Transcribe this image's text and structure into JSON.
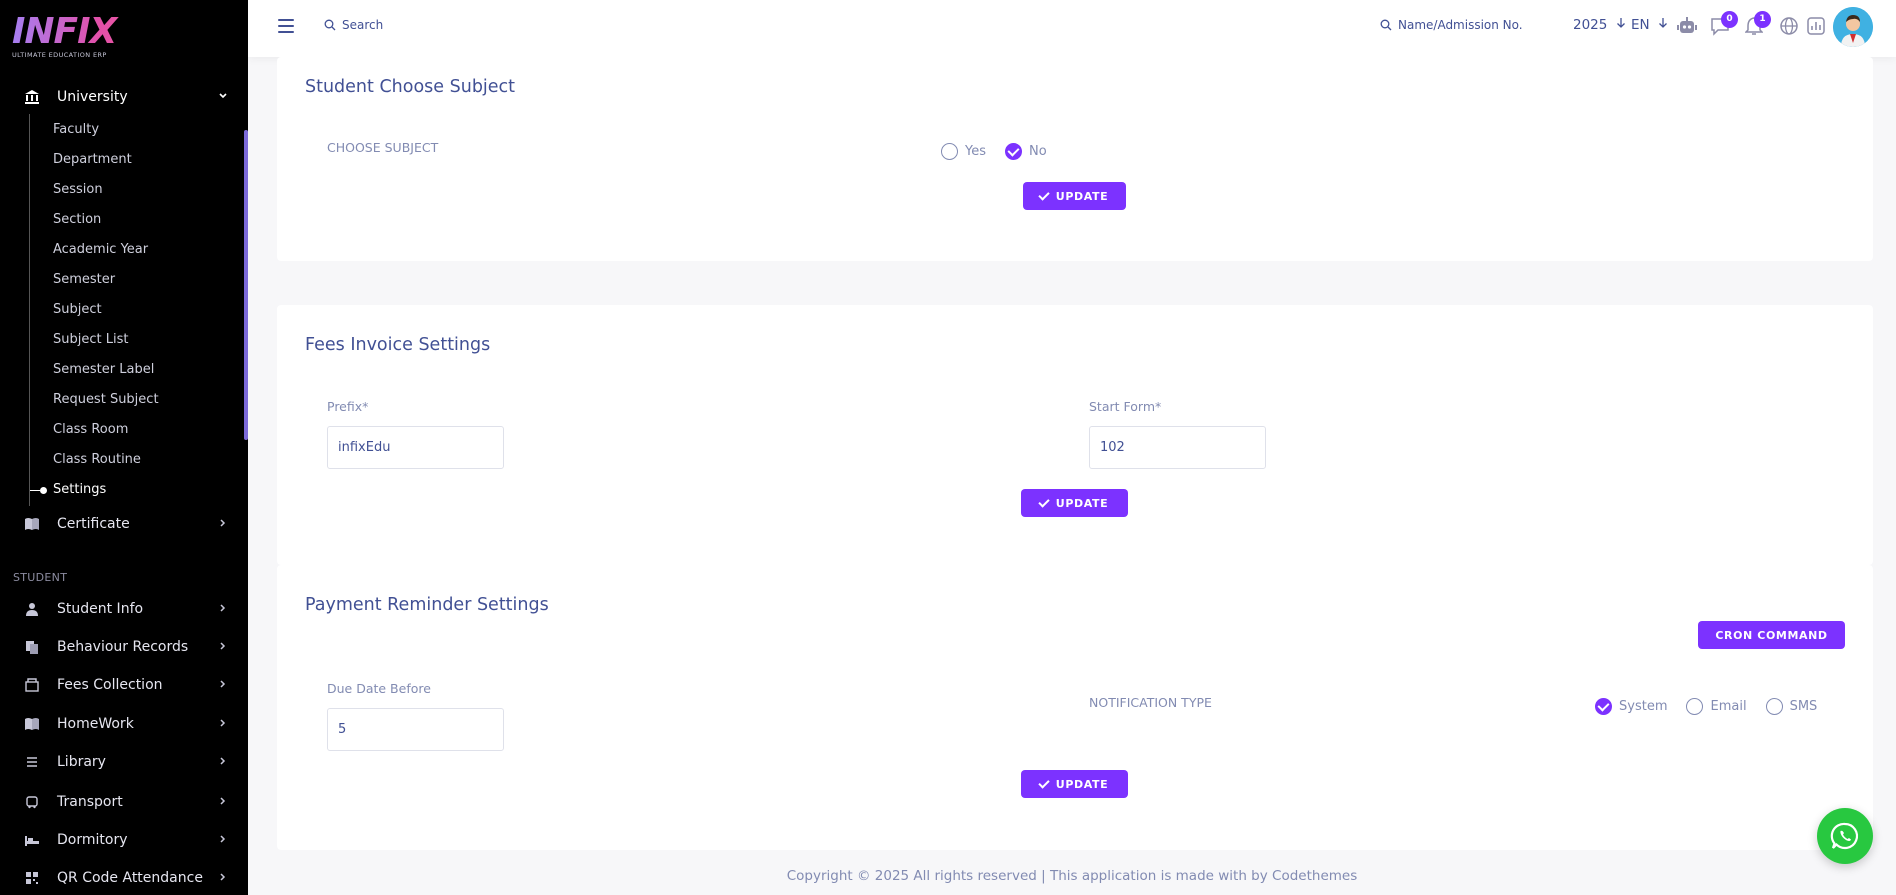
{
  "brand": {
    "logo_text": "INFIX",
    "tagline": "ULTIMATE EDUCATION ERP"
  },
  "sidebar": {
    "university": {
      "label": "University",
      "expanded": true
    },
    "sub_items": [
      {
        "label": "Faculty"
      },
      {
        "label": "Department"
      },
      {
        "label": "Session"
      },
      {
        "label": "Section"
      },
      {
        "label": "Academic Year"
      },
      {
        "label": "Semester"
      },
      {
        "label": "Subject"
      },
      {
        "label": "Subject List"
      },
      {
        "label": "Semester Label"
      },
      {
        "label": "Request Subject"
      },
      {
        "label": "Class Room"
      },
      {
        "label": "Class Routine"
      },
      {
        "label": "Settings",
        "active": true
      }
    ],
    "certificate": {
      "label": "Certificate"
    },
    "section_student": "STUDENT",
    "student_items": [
      {
        "label": "Student Info",
        "icon": "user-icon"
      },
      {
        "label": "Behaviour Records",
        "icon": "records-icon"
      },
      {
        "label": "Fees Collection",
        "icon": "fees-icon"
      },
      {
        "label": "HomeWork",
        "icon": "book-icon"
      },
      {
        "label": "Library",
        "icon": "library-icon"
      },
      {
        "label": "Transport",
        "icon": "bus-icon"
      },
      {
        "label": "Dormitory",
        "icon": "bed-icon"
      },
      {
        "label": "QR Code Attendance",
        "icon": "qr-icon"
      }
    ]
  },
  "topbar": {
    "search_placeholder": "Search",
    "student_search_placeholder": "Name/Admission No.",
    "year": "2025",
    "language": "EN",
    "messages_count": "0",
    "notifications_count": "1"
  },
  "choose_subject": {
    "title": "Student Choose Subject",
    "label": "CHOOSE SUBJECT",
    "options": [
      {
        "label": "Yes",
        "checked": false
      },
      {
        "label": "No",
        "checked": true
      }
    ],
    "update_label": "UPDATE"
  },
  "fees_invoice": {
    "title": "Fees Invoice Settings",
    "prefix_label": "Prefix*",
    "prefix_value": "infixEdu",
    "start_label": "Start Form*",
    "start_value": "102",
    "update_label": "UPDATE"
  },
  "payment_reminder": {
    "title": "Payment Reminder Settings",
    "cron_label": "CRON COMMAND",
    "due_label": "Due Date Before",
    "due_value": "5",
    "notification_label": "NOTIFICATION TYPE",
    "notification_options": [
      {
        "label": "System",
        "checked": true
      },
      {
        "label": "Email",
        "checked": false
      },
      {
        "label": "SMS",
        "checked": false
      }
    ],
    "update_label": "UPDATE"
  },
  "footer": {
    "text": "Copyright © 2025 All rights reserved | This application is made with by Codethemes"
  },
  "colors": {
    "accent": "#7c32ff",
    "text": "#415094",
    "muted": "#828bb2",
    "whatsapp": "#28c840"
  }
}
